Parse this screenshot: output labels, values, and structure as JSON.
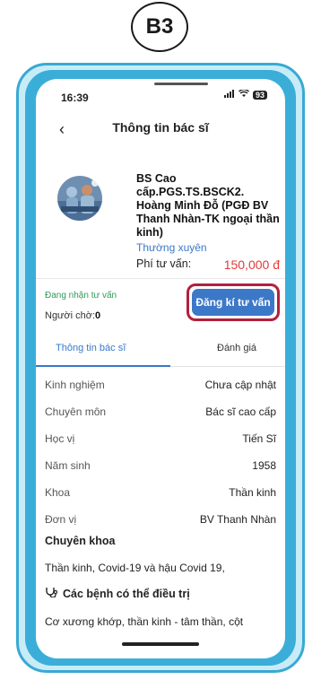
{
  "step_badge": "B3",
  "status_bar": {
    "time": "16:39",
    "battery": "93"
  },
  "header": {
    "title": "Thông tin bác sĩ",
    "back_icon": "‹"
  },
  "doctor": {
    "name": "BS Cao cấp.PGS.TS.BSCK2. Hoàng Minh Đỗ (PGĐ BV Thanh Nhàn-TK ngoại thần kinh)",
    "frequency_tag": "Thường xuyên",
    "fee_label": "Phí tư vấn:",
    "fee_value": "150,000 đ"
  },
  "consult": {
    "status": "Đang nhận tư vấn",
    "waiting_label": "Người chờ:",
    "waiting_count": "0",
    "register_label": "Đăng kí tư vấn"
  },
  "tabs": {
    "info": "Thông tin bác sĩ",
    "review": "Đánh giá"
  },
  "info_rows": [
    {
      "label": "Kinh nghiệm",
      "value": "Chưa cập nhật"
    },
    {
      "label": "Chuyên môn",
      "value": "Bác sĩ cao cấp"
    },
    {
      "label": "Học vị",
      "value": "Tiến Sĩ"
    },
    {
      "label": "Năm sinh",
      "value": "1958"
    },
    {
      "label": "Khoa",
      "value": "Thần kinh"
    },
    {
      "label": "Đơn vị",
      "value": "BV Thanh Nhàn"
    }
  ],
  "specialty": {
    "title": "Chuyên khoa",
    "text": "Thần kinh, Covid-19 và hậu Covid 19,"
  },
  "diseases": {
    "title": "Các bệnh có thể điều trị",
    "text": "Cơ xương khớp, thần kinh - tâm thần, cột"
  },
  "colors": {
    "accent": "#3c78c8",
    "highlight": "#b3203b",
    "fee": "#e23b3b",
    "online": "#2e9b55"
  }
}
